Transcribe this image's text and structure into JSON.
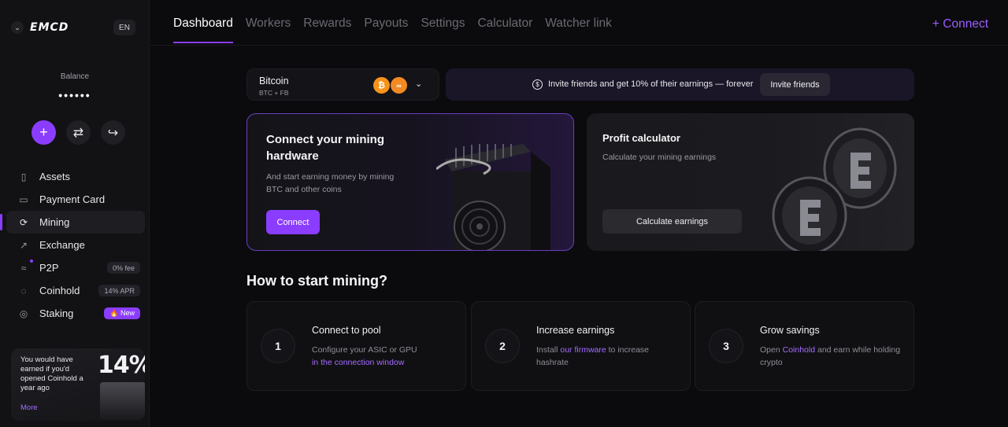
{
  "sidebar": {
    "logo": "EMCD",
    "lang": "EN",
    "balance_label": "Balance",
    "balance_value": "••••••",
    "items": [
      {
        "label": "Assets",
        "badge": ""
      },
      {
        "label": "Payment Card",
        "badge": ""
      },
      {
        "label": "Mining",
        "badge": ""
      },
      {
        "label": "Exchange",
        "badge": ""
      },
      {
        "label": "P2P",
        "badge": "0% fee"
      },
      {
        "label": "Coinhold",
        "badge": "14% APR"
      },
      {
        "label": "Staking",
        "badge": "🔥 New"
      }
    ],
    "promo": {
      "text": "You would have earned if you'd opened Coinhold a year ago",
      "more": "More",
      "big": "14%"
    }
  },
  "topnav": {
    "tabs": [
      "Dashboard",
      "Workers",
      "Rewards",
      "Payouts",
      "Settings",
      "Calculator",
      "Watcher link"
    ],
    "connect": "+ Connect"
  },
  "coin_selector": {
    "name": "Bitcoin",
    "sub": "BTC + FB"
  },
  "invite": {
    "text": "Invite friends and get 10% of their earnings — forever",
    "button": "Invite friends"
  },
  "hardware_card": {
    "title": "Connect your mining hardware",
    "desc": "And start earning money by mining BTC and other coins",
    "button": "Connect"
  },
  "calc_card": {
    "title": "Profit calculator",
    "desc": "Calculate your mining earnings",
    "button": "Calculate earnings"
  },
  "how_to": {
    "title": "How to start mining?",
    "steps": [
      {
        "num": "1",
        "title": "Connect to pool",
        "desc_a": "Configure your ASIC or GPU",
        "link": "in the connection window",
        "desc_b": ""
      },
      {
        "num": "2",
        "title": "Increase earnings",
        "desc_a": "Install",
        "link": "our firmware",
        "desc_b": "to increase hashrate"
      },
      {
        "num": "3",
        "title": "Grow savings",
        "desc_a": "Open",
        "link": "Coinhold",
        "desc_b": "and earn while holding crypto"
      }
    ]
  },
  "colors": {
    "accent": "#8b3dff",
    "bitcoin": "#f7931a"
  }
}
